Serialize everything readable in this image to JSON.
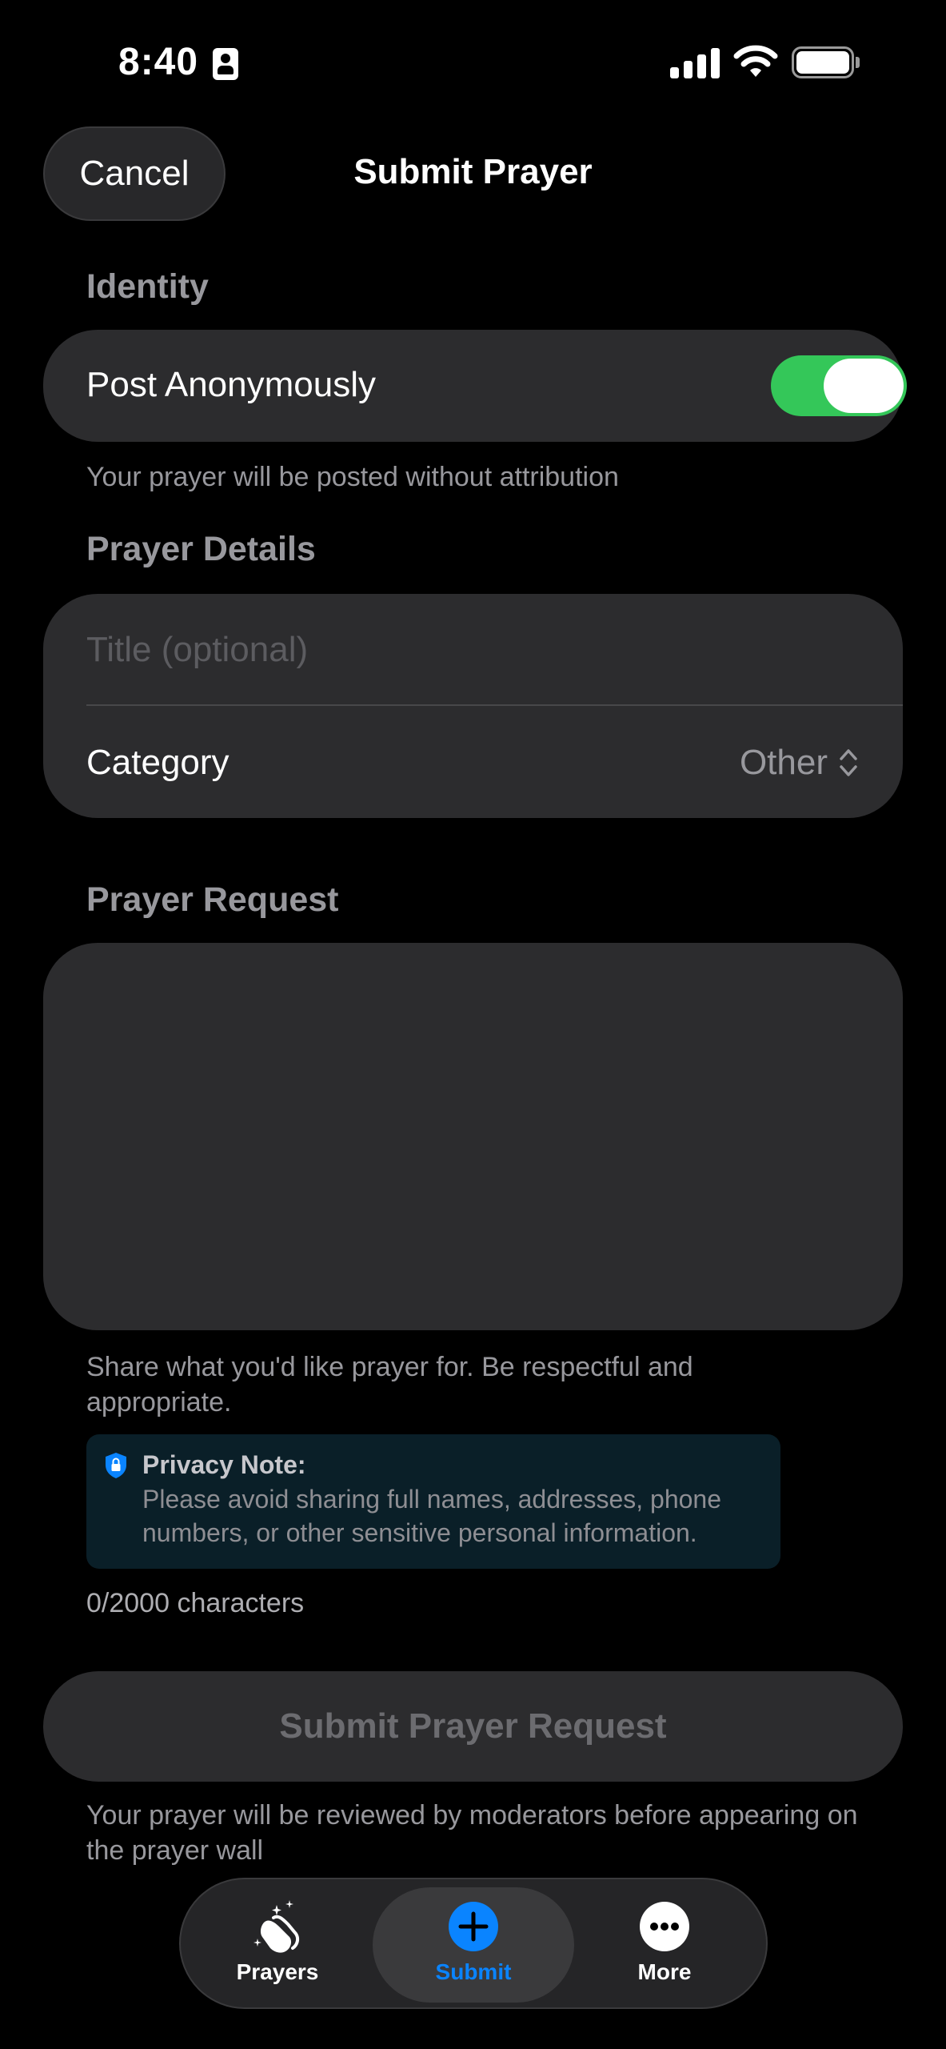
{
  "status_bar": {
    "time": "8:40"
  },
  "nav": {
    "cancel_label": "Cancel",
    "title": "Submit Prayer"
  },
  "identity": {
    "header": "Identity",
    "anonymous_label": "Post Anonymously",
    "anonymous_on": true,
    "footnote": "Your prayer will be posted without attribution"
  },
  "details": {
    "header": "Prayer Details",
    "title_placeholder": "Title (optional)",
    "title_value": "",
    "category_label": "Category",
    "category_value": "Other"
  },
  "request": {
    "header": "Prayer Request",
    "value": "",
    "hint": "Share what you'd like prayer for. Be respectful and appropriate.",
    "privacy_title": "Privacy Note:",
    "privacy_text": "Please avoid sharing full names, addresses, phone numbers, or other sensitive personal information.",
    "counter": "0/2000 characters"
  },
  "submit": {
    "label": "Submit Prayer Request",
    "footnote": "Your prayer will be reviewed by moderators before appearing on the prayer wall"
  },
  "tabs": [
    {
      "label": "Prayers",
      "icon": "praying-hands-icon",
      "active": false
    },
    {
      "label": "Submit",
      "icon": "plus-circle-icon",
      "active": true
    },
    {
      "label": "More",
      "icon": "ellipsis-circle-icon",
      "active": false
    }
  ],
  "colors": {
    "accent": "#0a84ff",
    "toggle_on": "#34c759",
    "card": "#2c2c2e"
  }
}
